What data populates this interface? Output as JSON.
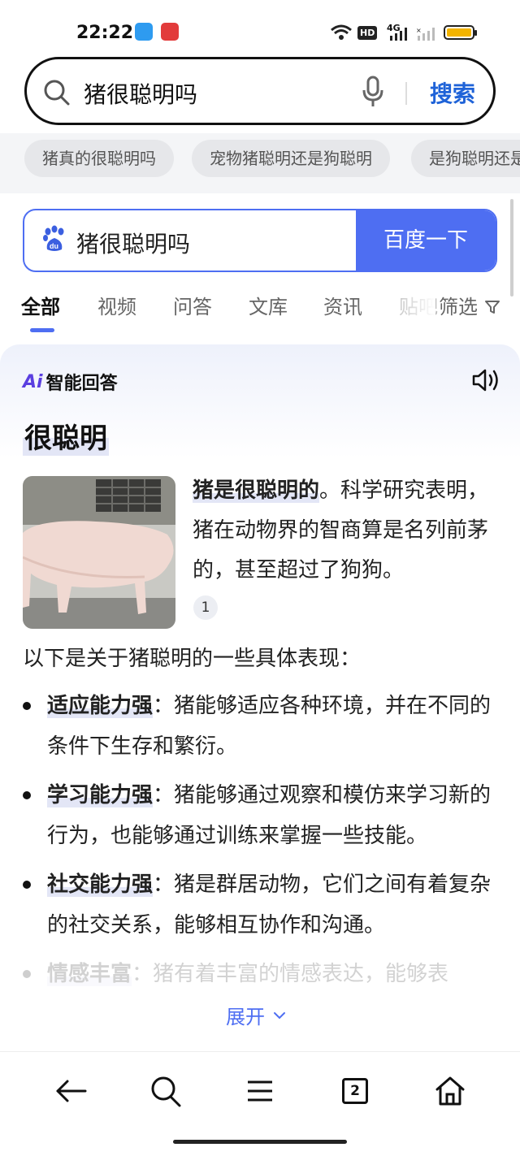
{
  "status_bar": {
    "time": "22:22",
    "network": "4G",
    "hd": "HD"
  },
  "browser_search": {
    "query": "猪很聪明吗",
    "button": "搜索"
  },
  "suggestions": [
    "猪真的很聪明吗",
    "宠物猪聪明还是狗聪明",
    "是狗聪明还是"
  ],
  "baidu_box": {
    "query": "猪很聪明吗",
    "button": "百度一下"
  },
  "tabs": [
    "全部",
    "视频",
    "问答",
    "文库",
    "资讯",
    "贴吧"
  ],
  "filter_label": "筛选",
  "answer": {
    "badge": "智能回答",
    "badge_ai": "Ai",
    "headline": "很聪明",
    "lead_bold": "猪是很聪明的",
    "lead_rest": "。科学研究表明，猪在动物界的智商算是名列前茅的，甚至超过了狗狗。",
    "citation": "1",
    "intro": "以下是关于猪聪明的一些具体表现：",
    "points": [
      {
        "keyword": "适应能力强",
        "text": "：猪能够适应各种环境，并在不同的条件下生存和繁衍。"
      },
      {
        "keyword": "学习能力强",
        "text": "：猪能够通过观察和模仿来学习新的行为，也能够通过训练来掌握一些技能。"
      },
      {
        "keyword": "社交能力强",
        "text": "：猪是群居动物，它们之间有着复杂的社交关系，能够相互协作和沟通。"
      },
      {
        "keyword": "情感丰富",
        "text": "：猪有着丰富的情感表达，能够表"
      }
    ],
    "expand_label": "展开"
  },
  "bottom_nav": {
    "tab_count": "2"
  },
  "colors": {
    "accent": "#4e6ef2",
    "link": "#1f63d8",
    "ai_purple": "#5b3fe0"
  }
}
